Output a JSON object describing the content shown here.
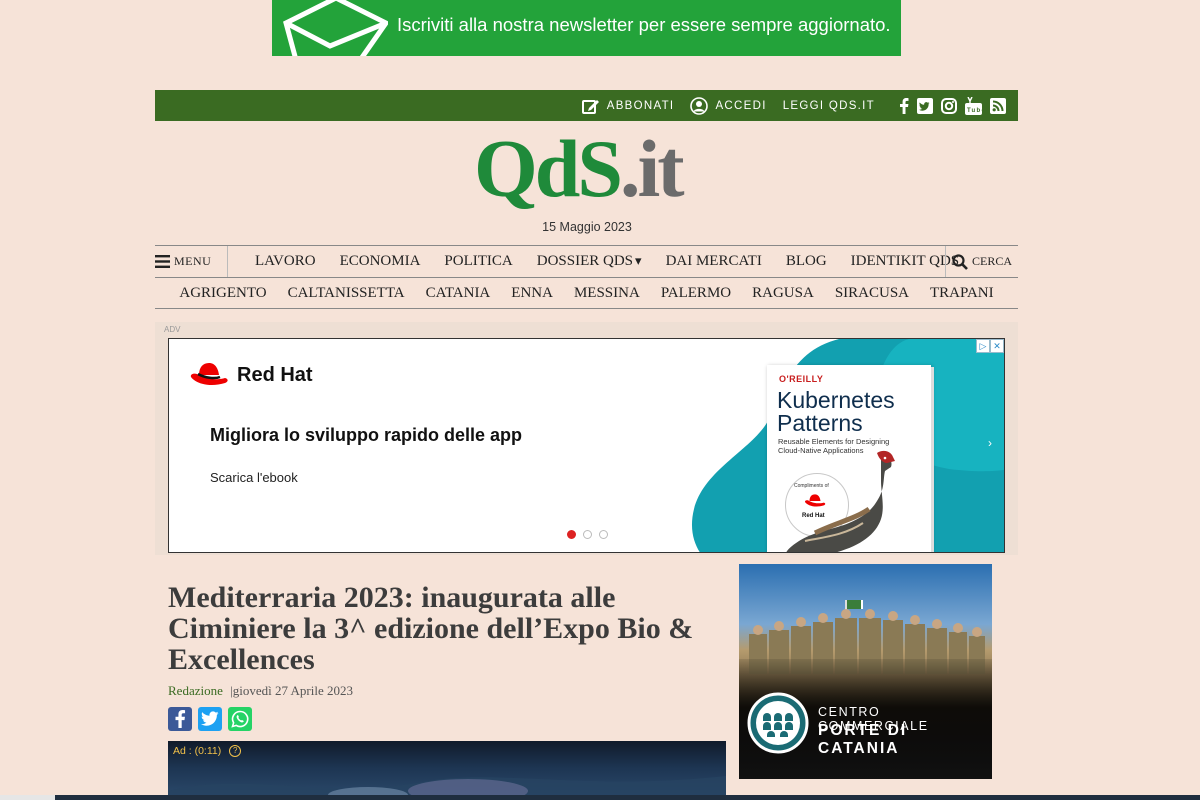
{
  "newsletter": {
    "text": "Iscriviti alla nostra newsletter per essere sempre aggiornato."
  },
  "topbar": {
    "subscribe": "ABBONATI",
    "login": "ACCEDI",
    "read": "LEGGI QDS.IT",
    "social_icons": [
      "facebook-icon",
      "twitter-icon",
      "instagram-icon",
      "youtube-icon",
      "rss-icon"
    ]
  },
  "logo": {
    "green": "QdS",
    "grey": ".it"
  },
  "date": "15 Maggio 2023",
  "nav": {
    "menu": "MENU",
    "search": "CERCA",
    "items": [
      "LAVORO",
      "ECONOMIA",
      "POLITICA",
      "DOSSIER QDS",
      "DAI MERCATI",
      "BLOG",
      "IDENTIKIT QDS"
    ],
    "provinces": [
      "AGRIGENTO",
      "CALTANISSETTA",
      "CATANIA",
      "ENNA",
      "MESSINA",
      "PALERMO",
      "RAGUSA",
      "SIRACUSA",
      "TRAPANI"
    ]
  },
  "ad_banner": {
    "label": "ADV",
    "brand": "Red Hat",
    "headline": "Migliora lo sviluppo rapido delle app",
    "cta": "Scarica l'ebook",
    "book_publisher": "O'REILLY",
    "book_title_1": "Kubernetes",
    "book_title_2": "Patterns",
    "book_sub_1": "Reusable Elements for Designing",
    "book_sub_2": "Cloud-Native Applications",
    "book_compliments": "Compliments of",
    "book_compliments_brand": "Red Hat",
    "arrow": "›"
  },
  "article": {
    "title": "Mediterraria 2023: inaugurata alle Ciminiere la 3^ edizione dell’Expo Bio & Excellences",
    "author": "Redazione",
    "sep": "|",
    "date": "giovedì 27 Aprile 2023"
  },
  "video": {
    "ad_time": "Ad : (0:11)",
    "help": "?"
  },
  "side_ad": {
    "line1": "CENTRO COMMERCIALE",
    "line2": "PORTE DI CATANIA"
  },
  "colors": {
    "page_bg": "#f6e3d8",
    "topbar": "#3a6b22",
    "newsletter": "#23a33a",
    "logo_green": "#1f8a3a"
  }
}
